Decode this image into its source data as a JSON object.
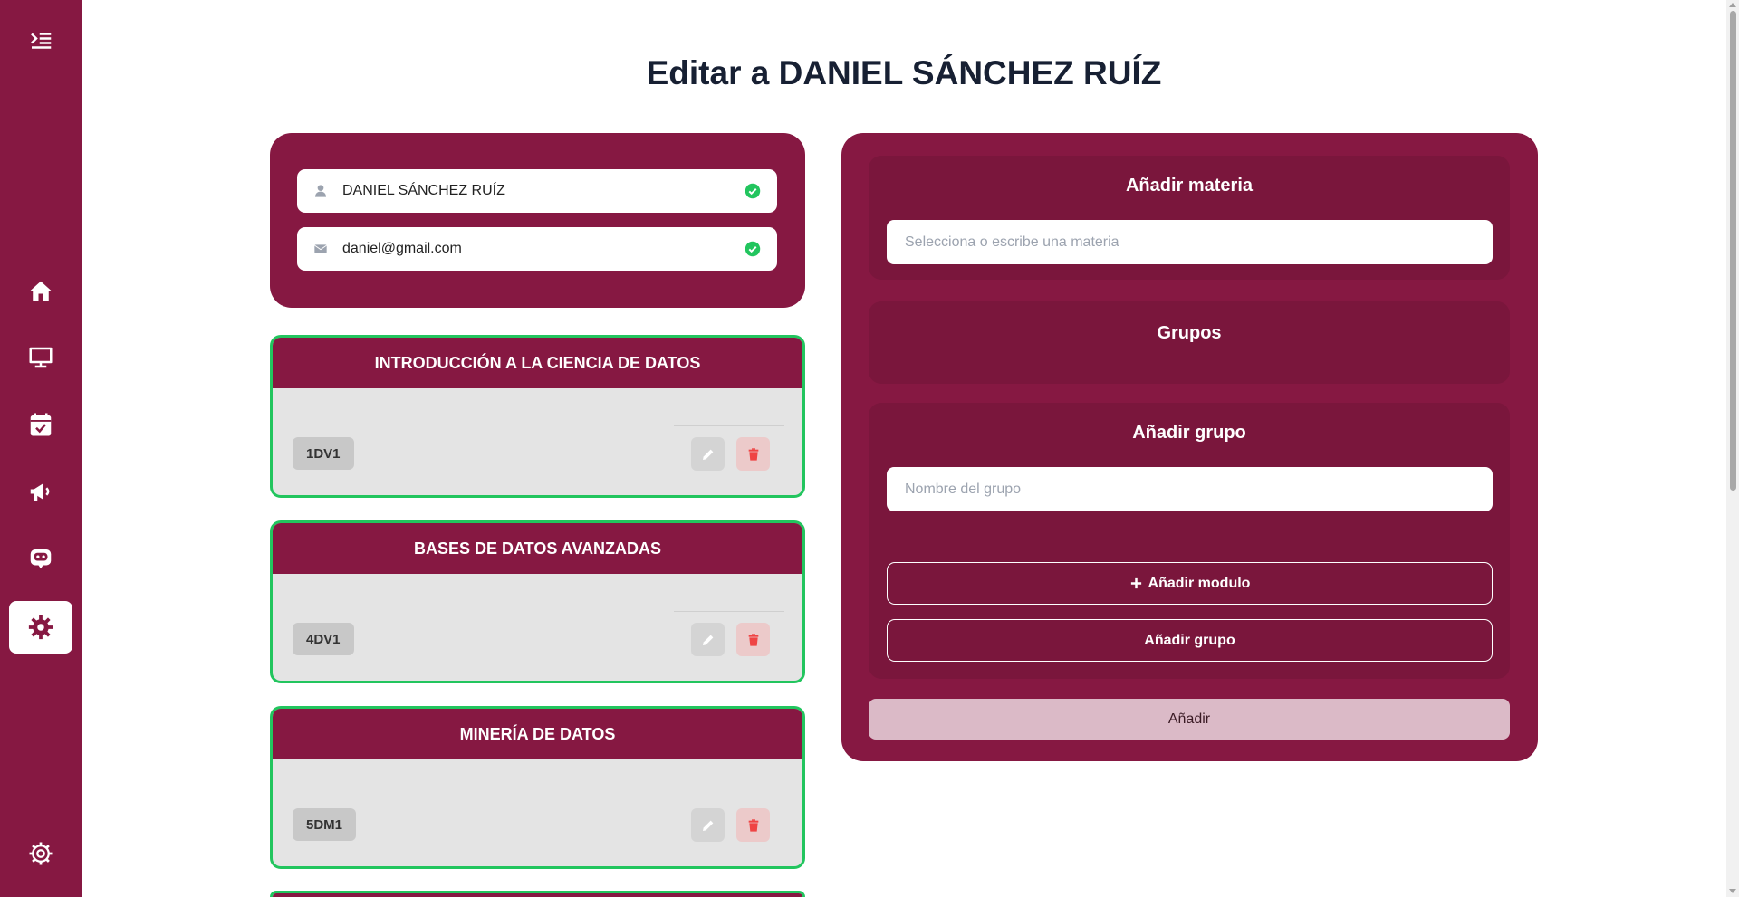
{
  "page": {
    "title": "Editar a DANIEL SÁNCHEZ RUÍZ"
  },
  "sidebar": {
    "items": [
      {
        "icon": "menu-toggle-icon"
      },
      {
        "icon": "home-icon"
      },
      {
        "icon": "monitor-icon"
      },
      {
        "icon": "calendar-check-icon"
      },
      {
        "icon": "megaphone-icon"
      },
      {
        "icon": "chatbot-icon"
      },
      {
        "icon": "settings-icon",
        "active": true
      },
      {
        "icon": "gear-outline-icon"
      }
    ]
  },
  "user": {
    "name": "DANIEL SÁNCHEZ RUÍZ",
    "email": "daniel@gmail.com"
  },
  "subjects": [
    {
      "title": "INTRODUCCIÓN A LA CIENCIA DE DATOS",
      "groups": [
        "1DV1"
      ]
    },
    {
      "title": "BASES DE DATOS AVANZADAS",
      "groups": [
        "4DV1"
      ]
    },
    {
      "title": "MINERÍA DE DATOS",
      "groups": [
        "5DM1"
      ]
    }
  ],
  "panel": {
    "add_subject_title": "Añadir materia",
    "subject_placeholder": "Selecciona o escribe una materia",
    "groups_title": "Grupos",
    "add_group_title": "Añadir grupo",
    "group_placeholder": "Nombre del grupo",
    "add_module_label": "Añadir modulo",
    "add_group_label": "Añadir grupo",
    "submit_label": "Añadir"
  },
  "colors": {
    "primary": "#861842",
    "section": "#7a163c",
    "success": "#22c55e",
    "danger": "#ef4444"
  }
}
